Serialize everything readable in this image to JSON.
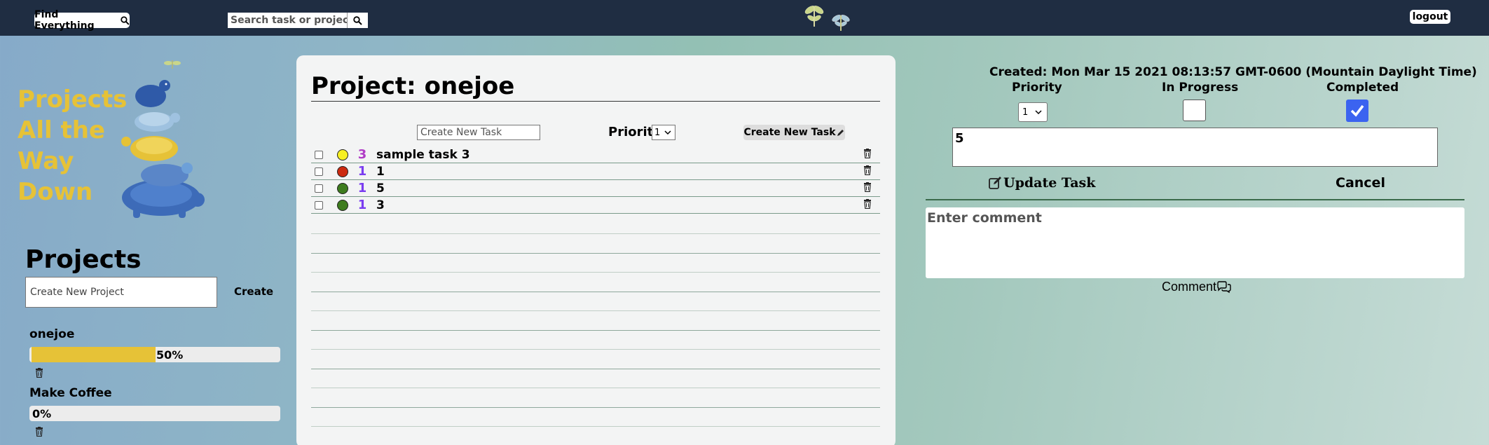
{
  "topbar": {
    "find_label": "Find Everything",
    "search_placeholder": "Search task or projects.",
    "logout_label": "logout"
  },
  "sidebar": {
    "title_lines": [
      "Projects",
      "All the",
      "Way",
      "Down"
    ],
    "projects_heading": "Projects",
    "new_project_placeholder": "Create New Project",
    "create_label": "Create",
    "projects": [
      {
        "name": "onejoe",
        "progress_label": "50%",
        "progress": 0.5
      },
      {
        "name": "Make Coffee",
        "progress_label": "0%",
        "progress": 0
      }
    ]
  },
  "main": {
    "project_title": "Project: onejoe",
    "new_task_placeholder": "Create New Task",
    "priority_label": "Priority",
    "priority_value": "1",
    "create_task_label": "Create New Task",
    "tasks": [
      {
        "priority": "3",
        "name": "sample task 3",
        "dot_color": "#f7f022",
        "priority_color": "#b03cc6"
      },
      {
        "priority": "1",
        "name": "1",
        "dot_color": "#cc2a10",
        "priority_color": "#7a3cf0"
      },
      {
        "priority": "1",
        "name": "5",
        "dot_color": "#3e7c1e",
        "priority_color": "#7a3cf0"
      },
      {
        "priority": "1",
        "name": "3",
        "dot_color": "#3e7c1e",
        "priority_color": "#7a3cf0"
      }
    ]
  },
  "detail": {
    "created": "Created: Mon Mar 15 2021 08:13:57 GMT-0600 (Mountain Daylight Time)",
    "priority_label": "Priority",
    "in_progress_label": "In Progress",
    "completed_label": "Completed",
    "priority_value": "1",
    "task_text": "5",
    "update_label": "Update Task",
    "cancel_label": "Cancel",
    "comment_placeholder": "Enter comment",
    "comment_label": "Comment"
  },
  "colors": {
    "topbar": "#1f2d42",
    "accent_yellow": "#e6c237",
    "checkbox_blue": "#3b63f0"
  }
}
